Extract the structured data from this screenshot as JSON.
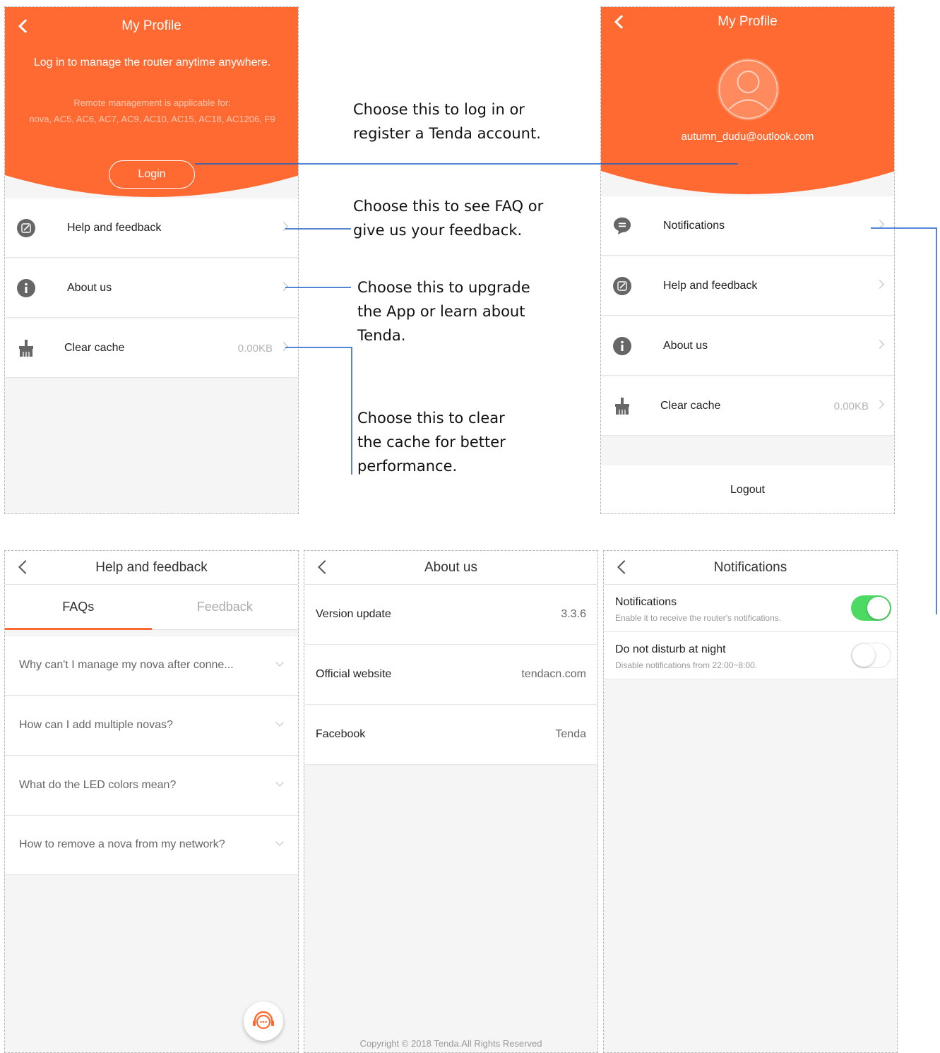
{
  "colors": {
    "accent": "#ff6a33",
    "toggle_on": "#4cd964",
    "line": "#1a5fc8"
  },
  "profile_logged_out": {
    "title": "My Profile",
    "message": "Log in to manage the router anytime anywhere.",
    "remote_note": "Remote management is applicable for:",
    "models": "nova, AC5, AC6, AC7, AC9, AC10, AC15, AC18, AC1206, F9",
    "login_label": "Login",
    "rows": [
      {
        "label": "Help and feedback",
        "icon": "edit-icon"
      },
      {
        "label": "About us",
        "icon": "info-icon"
      },
      {
        "label": "Clear cache",
        "value": "0.00KB",
        "icon": "broom-icon"
      }
    ]
  },
  "profile_logged_in": {
    "title": "My Profile",
    "email": "autumn_dudu@outlook.com",
    "rows": [
      {
        "label": "Notifications",
        "icon": "message-icon"
      },
      {
        "label": "Help and feedback",
        "icon": "edit-icon"
      },
      {
        "label": "About us",
        "icon": "info-icon"
      },
      {
        "label": "Clear cache",
        "value": "0.00KB",
        "icon": "broom-icon"
      }
    ],
    "logout_label": "Logout"
  },
  "help": {
    "title": "Help and feedback",
    "tabs": [
      "FAQs",
      "Feedback"
    ],
    "faqs": [
      "Why can't I manage my nova after conne...",
      "How can I add multiple novas?",
      "What do the LED colors mean?",
      "How to remove a nova from my network?"
    ]
  },
  "about": {
    "title": "About us",
    "rows": [
      {
        "label": "Version update",
        "value": "3.3.6"
      },
      {
        "label": "Official website",
        "value": "tendacn.com"
      },
      {
        "label": "Facebook",
        "value": "Tenda"
      }
    ],
    "copyright": "Copyright © 2018 Tenda.All Rights Reserved"
  },
  "notifications": {
    "title": "Notifications",
    "items": [
      {
        "title": "Notifications",
        "desc": "Enable it to receive the router's notifications.",
        "enabled": true
      },
      {
        "title": "Do not disturb at night",
        "desc": "Disable notifications from 22:00~8:00.",
        "enabled": false
      }
    ]
  },
  "callouts": {
    "login": [
      "Choose this to log in or",
      "register a Tenda account."
    ],
    "help": [
      "Choose this to see FAQ or",
      "give us your feedback."
    ],
    "about": [
      "Choose this to upgrade",
      "the App or learn about",
      "Tenda."
    ],
    "cache": [
      "Choose this to clear",
      "the cache for better",
      "performance."
    ]
  }
}
